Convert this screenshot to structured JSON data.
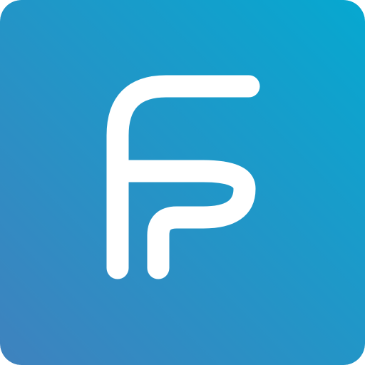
{
  "icon": {
    "name": "ff-monogram-app-icon",
    "glyph_color": "#ffffff",
    "background_gradient": {
      "start_color": "#06a8d0",
      "end_color": "#3f82be",
      "direction": "top-right-to-bottom-left"
    }
  }
}
